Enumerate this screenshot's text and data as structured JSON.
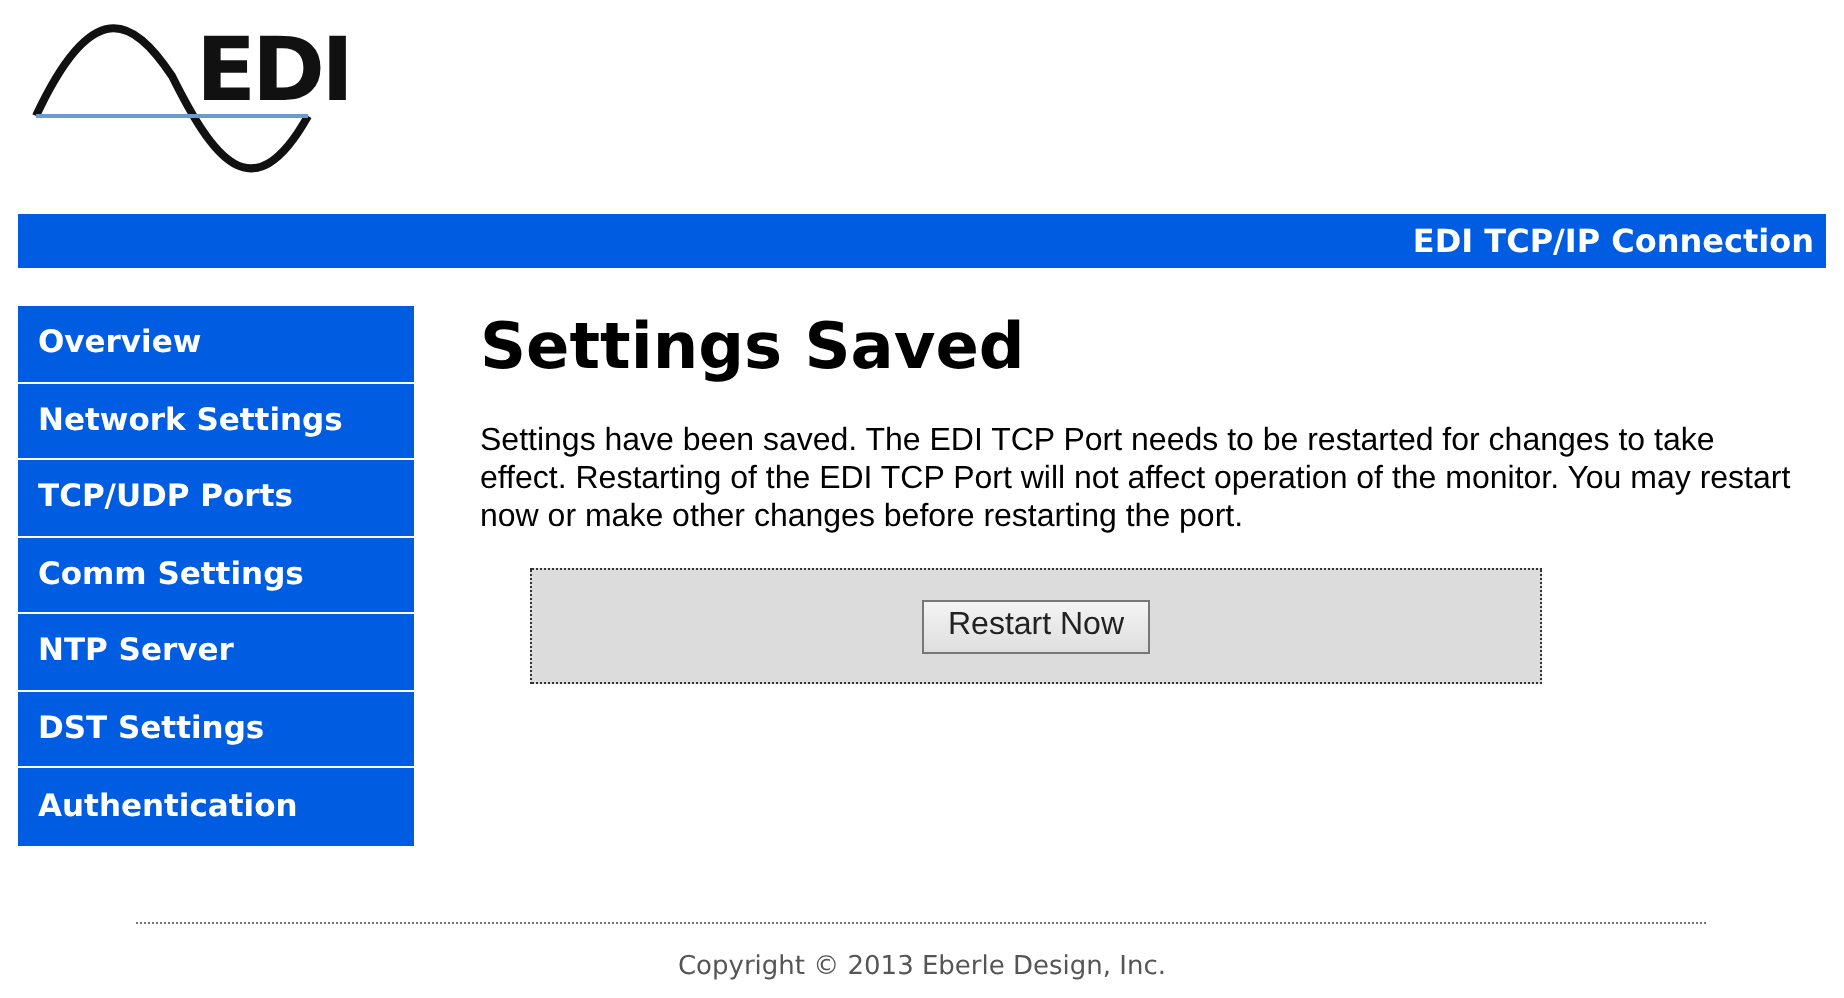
{
  "logo": {
    "text": "EDI"
  },
  "header_bar": {
    "title": "EDI TCP/IP Connection"
  },
  "sidebar": {
    "items": [
      {
        "label": "Overview"
      },
      {
        "label": "Network Settings"
      },
      {
        "label": "TCP/UDP Ports"
      },
      {
        "label": "Comm Settings"
      },
      {
        "label": "NTP Server"
      },
      {
        "label": "DST Settings"
      },
      {
        "label": "Authentication"
      }
    ]
  },
  "content": {
    "heading": "Settings Saved",
    "message": "Settings have been saved. The EDI TCP Port needs to be restarted for changes to take effect. Restarting of the EDI TCP Port will not affect operation of the monitor. You may restart now or make other changes before restarting the port.",
    "button": "Restart Now"
  },
  "footer": {
    "copyright": "Copyright © 2013 Eberle Design, Inc."
  }
}
